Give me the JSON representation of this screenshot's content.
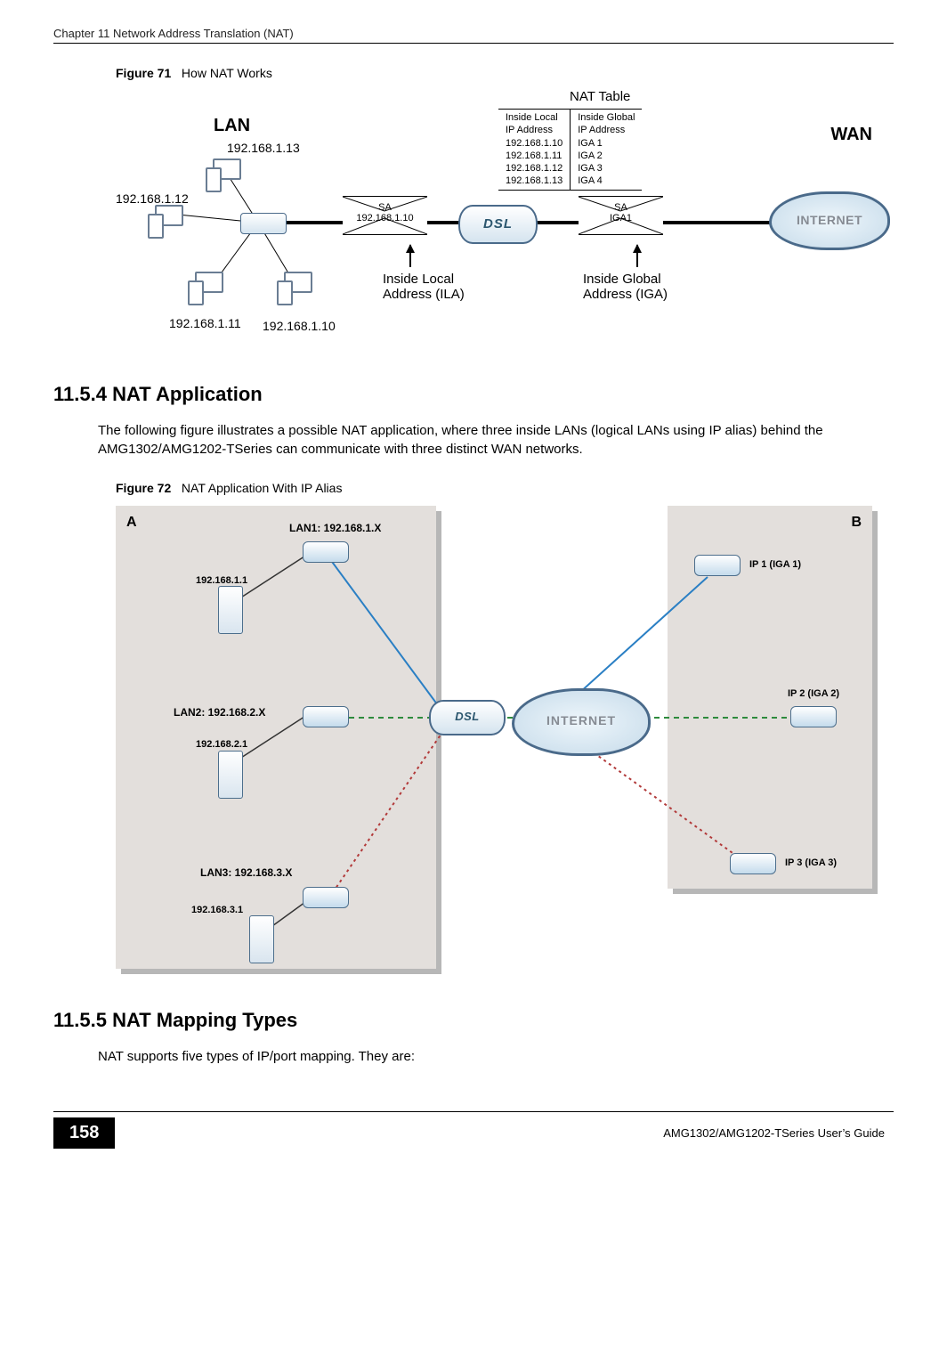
{
  "header": {
    "chapter": "Chapter 11 Network Address Translation (NAT)"
  },
  "figure71": {
    "label": "Figure 71",
    "title": "How NAT Works",
    "lan": "LAN",
    "wan": "WAN",
    "nat_table_label": "NAT Table",
    "col1_header": "Inside Local",
    "col1_sub": "IP Address",
    "col2_header": "Inside Global",
    "col2_sub": "IP Address",
    "local_ips": [
      "192.168.1.10",
      "192.168.1.11",
      "192.168.1.12",
      "192.168.1.13"
    ],
    "global_ips": [
      "IGA 1",
      "IGA 2",
      "IGA 3",
      "IGA 4"
    ],
    "pc_ips": {
      "top": "192.168.1.13",
      "left": "192.168.1.12",
      "bottom_left": "192.168.1.11",
      "bottom_right": "192.168.1.10"
    },
    "packet1": {
      "sa": "SA",
      "ip": "192.168.1.10"
    },
    "packet2": {
      "sa": "SA",
      "ip": "IGA1"
    },
    "ila": "Inside Local",
    "ila2": "Address (ILA)",
    "iga": "Inside Global",
    "iga2": "Address (IGA)",
    "internet": "INTERNET",
    "dsl": "DSL"
  },
  "section_11_5_4": {
    "heading": "11.5.4  NAT Application",
    "paragraph": "The following figure illustrates a possible NAT application, where three inside LANs (logical LANs using IP alias) behind the AMG1302/AMG1202-TSeries can communicate with three distinct WAN networks."
  },
  "figure72": {
    "label": "Figure 72",
    "title": "NAT Application With IP Alias",
    "panelA": "A",
    "panelB": "B",
    "lan1": "LAN1: 192.168.1.X",
    "lan2": "LAN2: 192.168.2.X",
    "lan3": "LAN3: 192.168.3.X",
    "srv1": "192.168.1.1",
    "srv2": "192.168.2.1",
    "srv3": "192.168.3.1",
    "ip1": "IP 1 (IGA 1)",
    "ip2": "IP 2 (IGA 2)",
    "ip3": "IP 3 (IGA 3)",
    "dsl": "DSL",
    "internet": "INTERNET"
  },
  "section_11_5_5": {
    "heading": "11.5.5  NAT Mapping Types",
    "paragraph": "NAT supports five types of IP/port mapping. They are:"
  },
  "footer": {
    "page": "158",
    "guide": "AMG1302/AMG1202-TSeries User’s Guide"
  }
}
